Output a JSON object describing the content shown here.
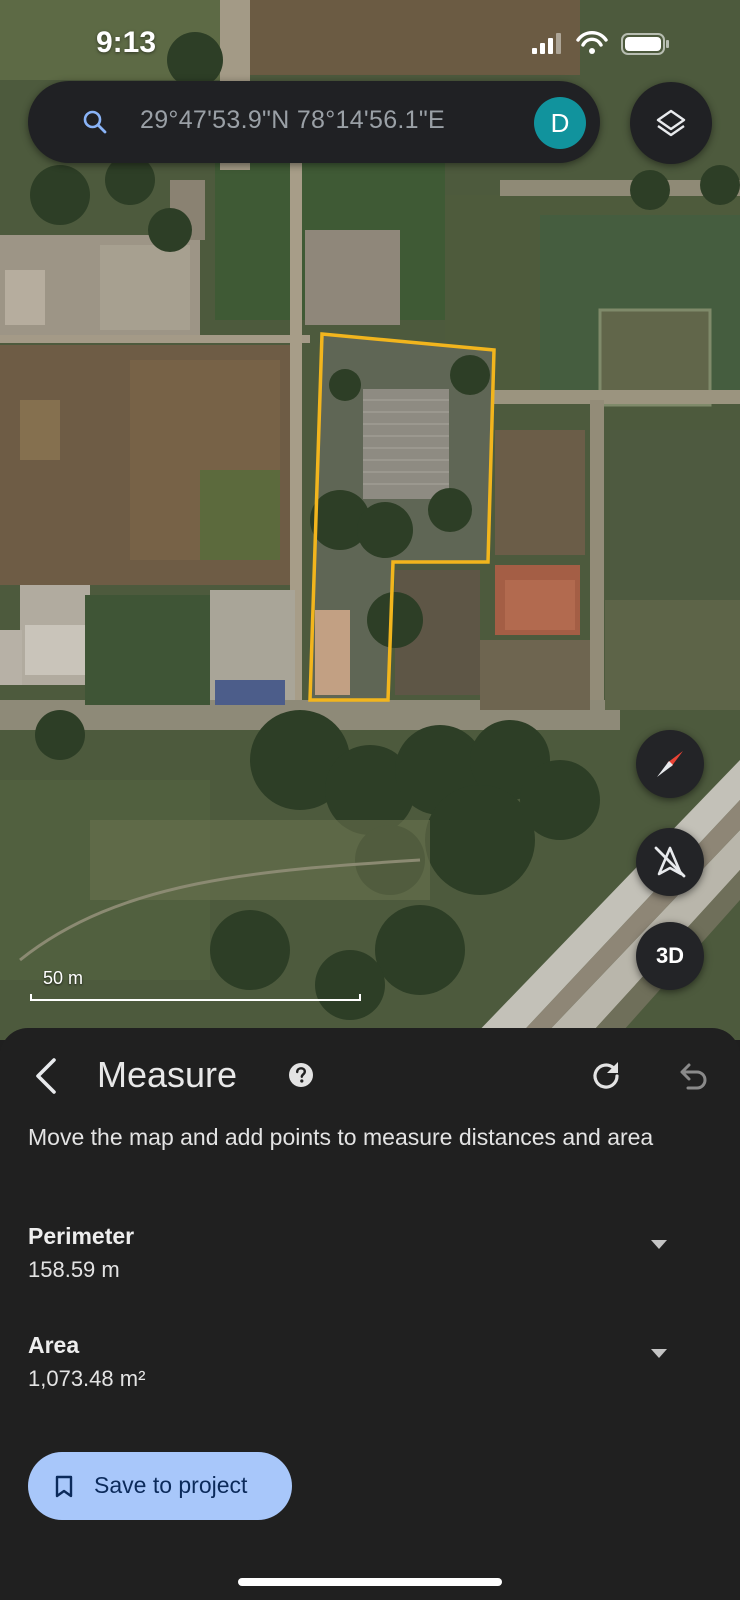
{
  "status_bar": {
    "time": "9:13"
  },
  "search": {
    "coordinates": "29°47'53.9\"N 78°14'56.1\"E"
  },
  "account": {
    "avatar_letter": "D",
    "avatar_color": "#11939d"
  },
  "map": {
    "scale_label": "50 m",
    "measured_outline_color": "#f2b51d",
    "buttons": {
      "three_d_label": "3D"
    }
  },
  "measure_panel": {
    "title": "Measure",
    "description": "Move the map and add points to measure distances and area",
    "perimeter": {
      "label": "Perimeter",
      "value": "158.59 m"
    },
    "area": {
      "label": "Area",
      "value": "1,073.48 m²"
    },
    "save_button_label": "Save to project",
    "accent_color": "#a8c7fa"
  }
}
